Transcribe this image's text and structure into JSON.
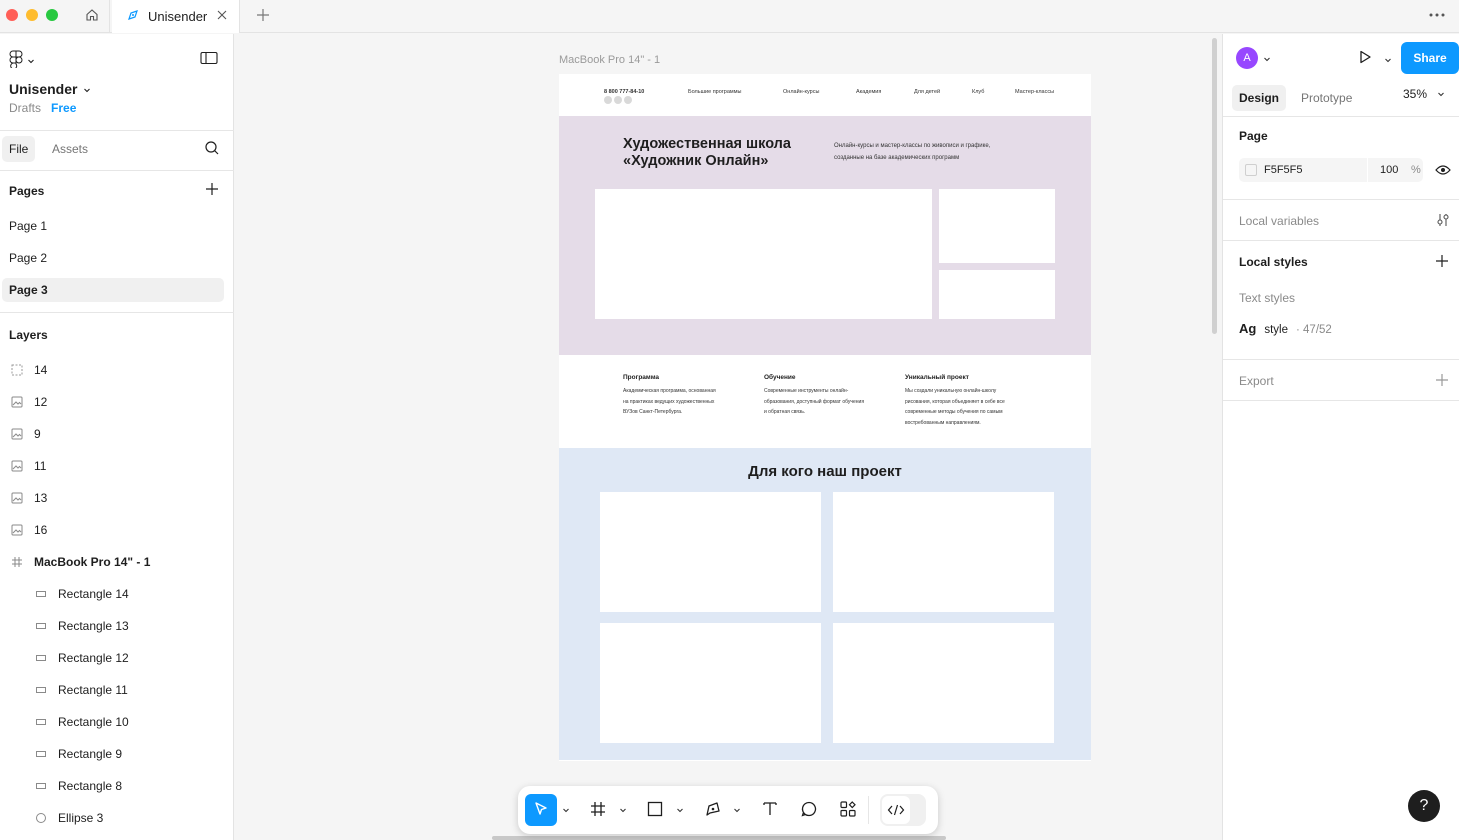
{
  "window": {
    "active_tab": "Unisender"
  },
  "left_panel": {
    "file_name": "Unisender",
    "location": "Drafts",
    "plan": "Free",
    "tabs": [
      "File",
      "Assets"
    ],
    "pages_title": "Pages",
    "pages": [
      {
        "label": "Page 1",
        "active": false
      },
      {
        "label": "Page 2",
        "active": false
      },
      {
        "label": "Page 3",
        "active": true
      }
    ],
    "layers_title": "Layers",
    "layers": [
      {
        "name": "14",
        "icon": "hidden-frame-icon",
        "indent": 0,
        "bold": false
      },
      {
        "name": "12",
        "icon": "image-icon",
        "indent": 0,
        "bold": false
      },
      {
        "name": "9",
        "icon": "image-icon",
        "indent": 0,
        "bold": false
      },
      {
        "name": "11",
        "icon": "image-icon",
        "indent": 0,
        "bold": false
      },
      {
        "name": "13",
        "icon": "image-icon",
        "indent": 0,
        "bold": false
      },
      {
        "name": "16",
        "icon": "image-icon",
        "indent": 0,
        "bold": false
      },
      {
        "name": "MacBook Pro 14\" - 1",
        "icon": "frame-icon",
        "indent": 0,
        "bold": true
      },
      {
        "name": "Rectangle 14",
        "icon": "rectangle-icon",
        "indent": 1,
        "bold": false
      },
      {
        "name": "Rectangle 13",
        "icon": "rectangle-icon",
        "indent": 1,
        "bold": false
      },
      {
        "name": "Rectangle 12",
        "icon": "rectangle-icon",
        "indent": 1,
        "bold": false
      },
      {
        "name": "Rectangle 11",
        "icon": "rectangle-icon",
        "indent": 1,
        "bold": false
      },
      {
        "name": "Rectangle 10",
        "icon": "rectangle-icon",
        "indent": 1,
        "bold": false
      },
      {
        "name": "Rectangle 9",
        "icon": "rectangle-icon",
        "indent": 1,
        "bold": false
      },
      {
        "name": "Rectangle 8",
        "icon": "rectangle-icon",
        "indent": 1,
        "bold": false
      },
      {
        "name": "Ellipse 3",
        "icon": "ellipse-icon",
        "indent": 1,
        "bold": false
      }
    ]
  },
  "canvas": {
    "frame_label": "MacBook Pro 14\" - 1",
    "background": "#F5F5F5",
    "design": {
      "nav": {
        "phone": "8 800 777-84-10",
        "links": [
          "Большие программы",
          "Онлайн-курсы",
          "Академия",
          "Для детей",
          "Клуб",
          "Мастер-классы"
        ]
      },
      "hero": {
        "title": "Художественная школа\n«Художник Онлайн»",
        "subtitle": "Онлайн-курсы и мастер-классы по живописи и графике,\nсозданные на базе академических программ",
        "color": "#E5DCE8"
      },
      "features": [
        {
          "title": "Программа",
          "text": "Академическая программа, основанная\nна практиках ведущих художественных\nВУЗов Санкт-Петербурга."
        },
        {
          "title": "Обучение",
          "text": "Современные инструменты онлайн-\nобразования, доступный формат обучения\nи обратная связь."
        },
        {
          "title": "Уникальный проект",
          "text": "Мы создали уникальную онлайн-школу\nрисования, которая объединяет в себе все\nсовременные методы обучения по самым\nвостребованным направлениям."
        }
      ],
      "audience": {
        "title": "Для кого наш проект",
        "color": "#DFE8F5"
      }
    }
  },
  "toolbar": {
    "tools": [
      "move-tool",
      "frame-tool",
      "shape-tool",
      "pen-tool",
      "text-tool",
      "comment-tool",
      "actions-tool",
      "dev-mode-toggle"
    ],
    "active_tool": "move-tool",
    "accent": "#0D99FF"
  },
  "right_panel": {
    "avatar_initial": "A",
    "share_label": "Share",
    "tabs": [
      "Design",
      "Prototype"
    ],
    "active_tab": "Design",
    "zoom": "35%",
    "page_section": "Page",
    "page_fill_hex": "F5F5F5",
    "page_fill_opacity": "100",
    "percent_sign": "%",
    "local_variables": "Local variables",
    "local_styles": "Local styles",
    "text_styles_label": "Text styles",
    "style_preview": "Ag",
    "style_name": "style",
    "style_meta": "· 47/52",
    "export_label": "Export",
    "help": "?"
  }
}
